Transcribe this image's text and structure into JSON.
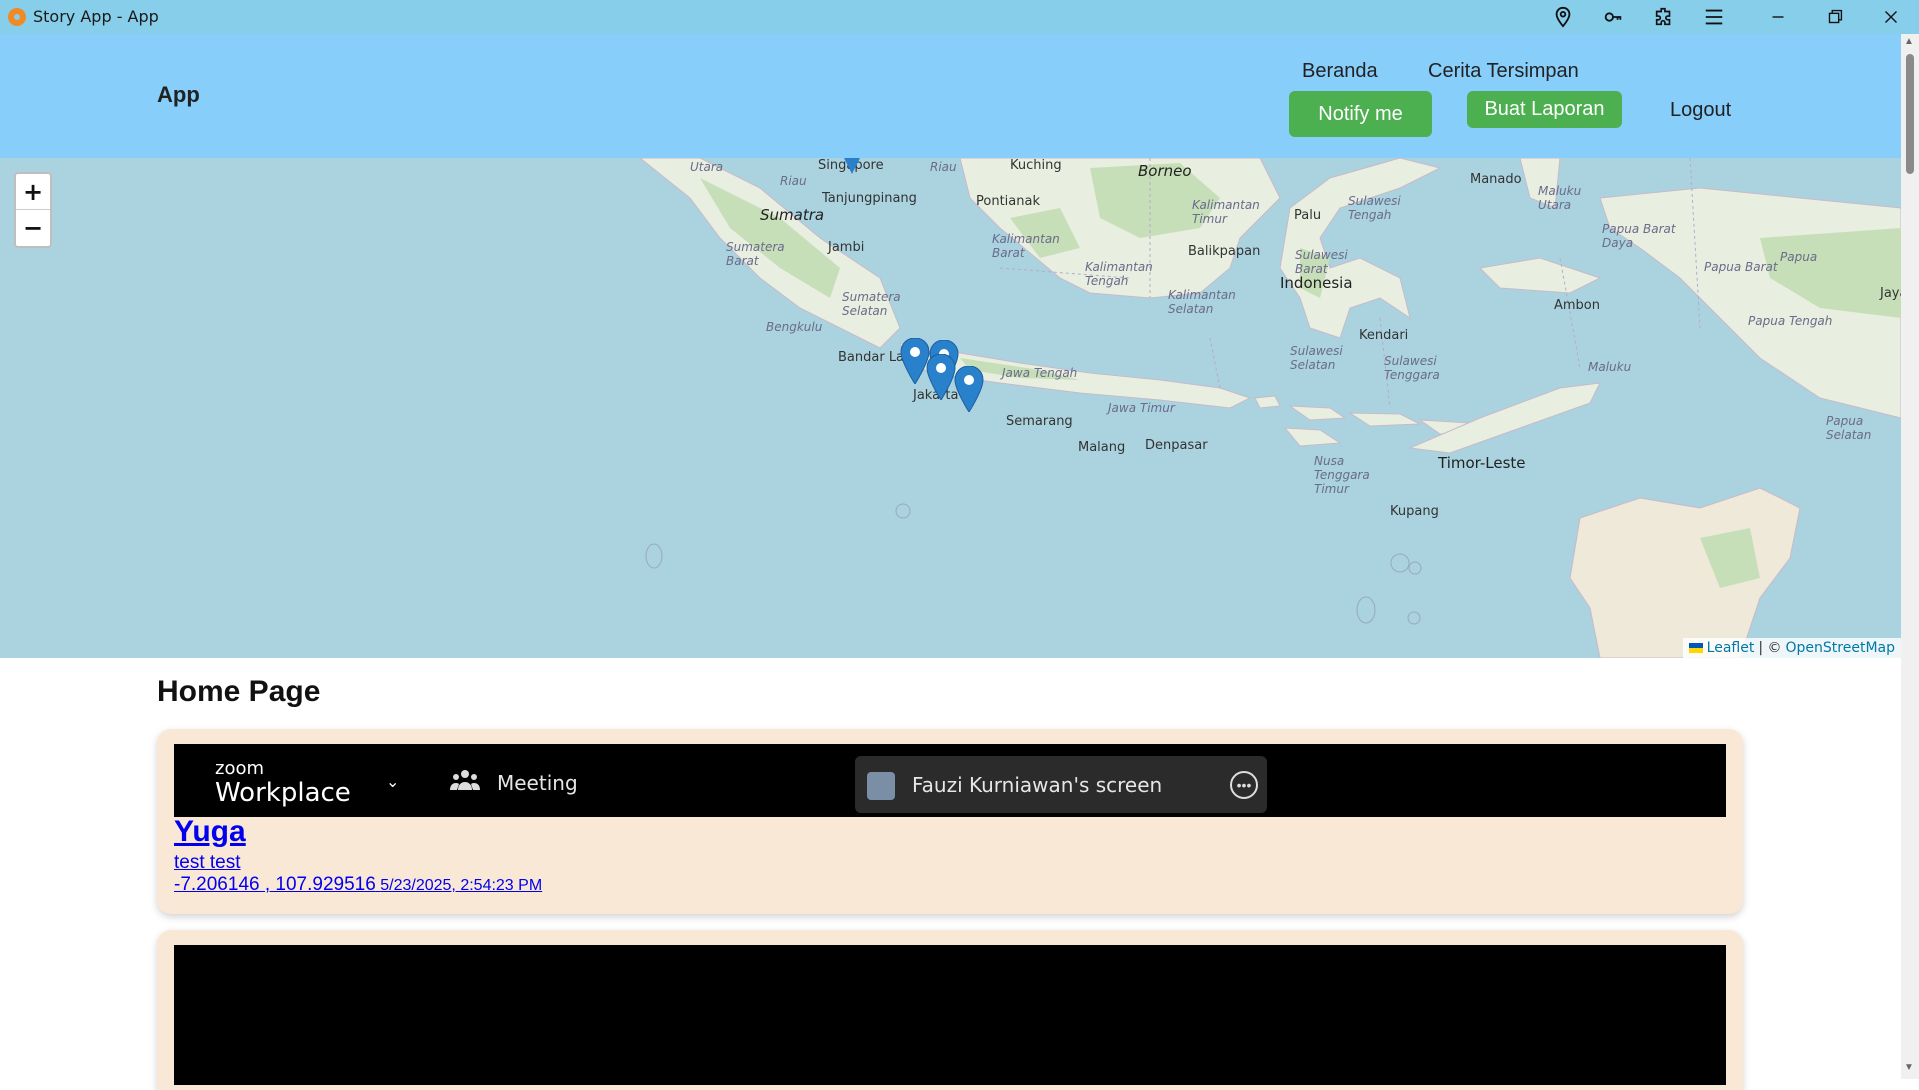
{
  "window": {
    "title": "Story App - App"
  },
  "header": {
    "brand": "App",
    "nav": {
      "home": "Beranda",
      "saved": "Cerita Tersimpan",
      "notify": "Notify me",
      "create": "Buat Laporan",
      "logout": "Logout"
    }
  },
  "map": {
    "zoom_in": "+",
    "zoom_out": "−",
    "labels": {
      "singapore": "Singapore",
      "tanjungpinang": "Tanjungpinang",
      "sumatra": "Sumatra",
      "jambi": "Jambi",
      "bandar_lampung": "Bandar La",
      "jakarta": "Jakarta",
      "semarang": "Semarang",
      "malang": "Malang",
      "denpasar": "Denpasar",
      "pontianak": "Pontianak",
      "borneo": "Borneo",
      "balikpapan": "Balikpapan",
      "palu": "Palu",
      "indonesia": "Indonesia",
      "manado": "Manado",
      "kendari": "Kendari",
      "ambon": "Ambon",
      "timor_leste": "Timor-Leste",
      "kupang": "Kupang",
      "kuching": "Kuching",
      "riau": "Riau",
      "sumatera_barat": "Sumatera Barat",
      "sumatera_selatan": "Sumatera Selatan",
      "bengkulu": "Bengkulu",
      "jawa_tengah": "Jawa Tengah",
      "jawa_timur": "Jawa Timur",
      "kalimantan_barat": "Kalimantan Barat",
      "kalimantan_tengah": "Kalimantan Tengah",
      "kalimantan_timur": "Kalimantan Timur",
      "kalimantan_selatan": "Kalimantan Selatan",
      "sulawesi_tengah": "Sulawesi Tengah",
      "sulawesi_barat": "Sulawesi Barat",
      "sulawesi_selatan": "Sulawesi Selatan",
      "sulawesi_tenggara": "Sulawesi Tenggara",
      "maluku_utara": "Maluku Utara",
      "maluku": "Maluku",
      "papua_barat_daya": "Papua Barat Daya",
      "papua_barat": "Papua Barat",
      "papua": "Papua",
      "papua_tengah": "Papua Tengah",
      "papua_selatan": "Papua Selatan",
      "nusa_tenggara_timur": "Nusa Tenggara Timur",
      "jaya": "Jaya",
      "utara": "Utara"
    },
    "attribution": {
      "leaflet": "Leaflet",
      "separator": "| ©",
      "osm": "OpenStreetMap"
    }
  },
  "content": {
    "page_title": "Home Page",
    "stories": [
      {
        "image": {
          "zoom_brand_small": "zoom",
          "zoom_brand_big": "Workplace",
          "meeting_label": "Meeting",
          "share_label": "Fauzi Kurniawan's screen"
        },
        "name": "Yuga",
        "description": "test test",
        "coords": "-7.206146 , 107.929516",
        "date": "5/23/2025, 2:54:23 PM"
      }
    ]
  },
  "colors": {
    "titlebar": "#87ceeb",
    "header": "#87cefa",
    "button_green": "#4caf50",
    "card_bg": "#f9e8d6",
    "link": "#0000ee",
    "sea": "#aad3df",
    "marker": "#2a81cb"
  }
}
